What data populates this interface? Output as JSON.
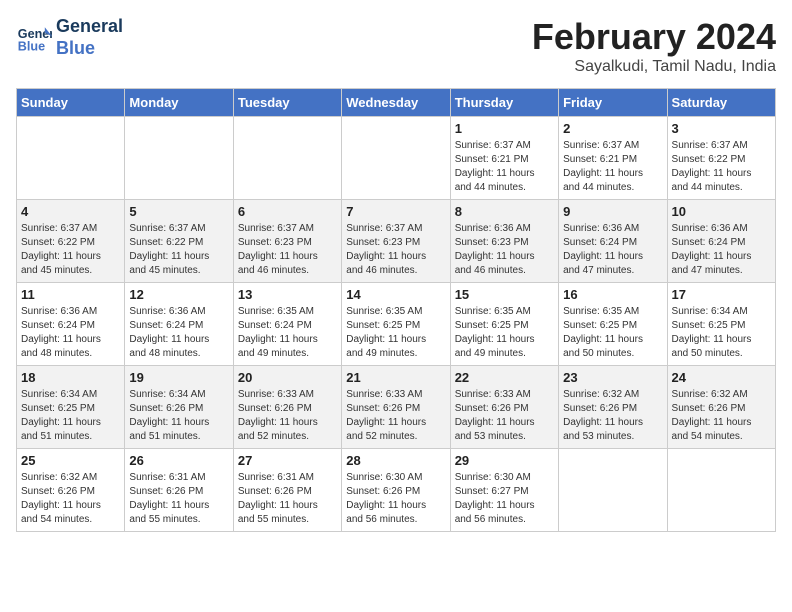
{
  "header": {
    "logo_line1": "General",
    "logo_line2": "Blue",
    "month_title": "February 2024",
    "location": "Sayalkudi, Tamil Nadu, India"
  },
  "days_of_week": [
    "Sunday",
    "Monday",
    "Tuesday",
    "Wednesday",
    "Thursday",
    "Friday",
    "Saturday"
  ],
  "weeks": [
    [
      {
        "day": "",
        "info": ""
      },
      {
        "day": "",
        "info": ""
      },
      {
        "day": "",
        "info": ""
      },
      {
        "day": "",
        "info": ""
      },
      {
        "day": "1",
        "info": "Sunrise: 6:37 AM\nSunset: 6:21 PM\nDaylight: 11 hours\nand 44 minutes."
      },
      {
        "day": "2",
        "info": "Sunrise: 6:37 AM\nSunset: 6:21 PM\nDaylight: 11 hours\nand 44 minutes."
      },
      {
        "day": "3",
        "info": "Sunrise: 6:37 AM\nSunset: 6:22 PM\nDaylight: 11 hours\nand 44 minutes."
      }
    ],
    [
      {
        "day": "4",
        "info": "Sunrise: 6:37 AM\nSunset: 6:22 PM\nDaylight: 11 hours\nand 45 minutes."
      },
      {
        "day": "5",
        "info": "Sunrise: 6:37 AM\nSunset: 6:22 PM\nDaylight: 11 hours\nand 45 minutes."
      },
      {
        "day": "6",
        "info": "Sunrise: 6:37 AM\nSunset: 6:23 PM\nDaylight: 11 hours\nand 46 minutes."
      },
      {
        "day": "7",
        "info": "Sunrise: 6:37 AM\nSunset: 6:23 PM\nDaylight: 11 hours\nand 46 minutes."
      },
      {
        "day": "8",
        "info": "Sunrise: 6:36 AM\nSunset: 6:23 PM\nDaylight: 11 hours\nand 46 minutes."
      },
      {
        "day": "9",
        "info": "Sunrise: 6:36 AM\nSunset: 6:24 PM\nDaylight: 11 hours\nand 47 minutes."
      },
      {
        "day": "10",
        "info": "Sunrise: 6:36 AM\nSunset: 6:24 PM\nDaylight: 11 hours\nand 47 minutes."
      }
    ],
    [
      {
        "day": "11",
        "info": "Sunrise: 6:36 AM\nSunset: 6:24 PM\nDaylight: 11 hours\nand 48 minutes."
      },
      {
        "day": "12",
        "info": "Sunrise: 6:36 AM\nSunset: 6:24 PM\nDaylight: 11 hours\nand 48 minutes."
      },
      {
        "day": "13",
        "info": "Sunrise: 6:35 AM\nSunset: 6:24 PM\nDaylight: 11 hours\nand 49 minutes."
      },
      {
        "day": "14",
        "info": "Sunrise: 6:35 AM\nSunset: 6:25 PM\nDaylight: 11 hours\nand 49 minutes."
      },
      {
        "day": "15",
        "info": "Sunrise: 6:35 AM\nSunset: 6:25 PM\nDaylight: 11 hours\nand 49 minutes."
      },
      {
        "day": "16",
        "info": "Sunrise: 6:35 AM\nSunset: 6:25 PM\nDaylight: 11 hours\nand 50 minutes."
      },
      {
        "day": "17",
        "info": "Sunrise: 6:34 AM\nSunset: 6:25 PM\nDaylight: 11 hours\nand 50 minutes."
      }
    ],
    [
      {
        "day": "18",
        "info": "Sunrise: 6:34 AM\nSunset: 6:25 PM\nDaylight: 11 hours\nand 51 minutes."
      },
      {
        "day": "19",
        "info": "Sunrise: 6:34 AM\nSunset: 6:26 PM\nDaylight: 11 hours\nand 51 minutes."
      },
      {
        "day": "20",
        "info": "Sunrise: 6:33 AM\nSunset: 6:26 PM\nDaylight: 11 hours\nand 52 minutes."
      },
      {
        "day": "21",
        "info": "Sunrise: 6:33 AM\nSunset: 6:26 PM\nDaylight: 11 hours\nand 52 minutes."
      },
      {
        "day": "22",
        "info": "Sunrise: 6:33 AM\nSunset: 6:26 PM\nDaylight: 11 hours\nand 53 minutes."
      },
      {
        "day": "23",
        "info": "Sunrise: 6:32 AM\nSunset: 6:26 PM\nDaylight: 11 hours\nand 53 minutes."
      },
      {
        "day": "24",
        "info": "Sunrise: 6:32 AM\nSunset: 6:26 PM\nDaylight: 11 hours\nand 54 minutes."
      }
    ],
    [
      {
        "day": "25",
        "info": "Sunrise: 6:32 AM\nSunset: 6:26 PM\nDaylight: 11 hours\nand 54 minutes."
      },
      {
        "day": "26",
        "info": "Sunrise: 6:31 AM\nSunset: 6:26 PM\nDaylight: 11 hours\nand 55 minutes."
      },
      {
        "day": "27",
        "info": "Sunrise: 6:31 AM\nSunset: 6:26 PM\nDaylight: 11 hours\nand 55 minutes."
      },
      {
        "day": "28",
        "info": "Sunrise: 6:30 AM\nSunset: 6:26 PM\nDaylight: 11 hours\nand 56 minutes."
      },
      {
        "day": "29",
        "info": "Sunrise: 6:30 AM\nSunset: 6:27 PM\nDaylight: 11 hours\nand 56 minutes."
      },
      {
        "day": "",
        "info": ""
      },
      {
        "day": "",
        "info": ""
      }
    ]
  ]
}
